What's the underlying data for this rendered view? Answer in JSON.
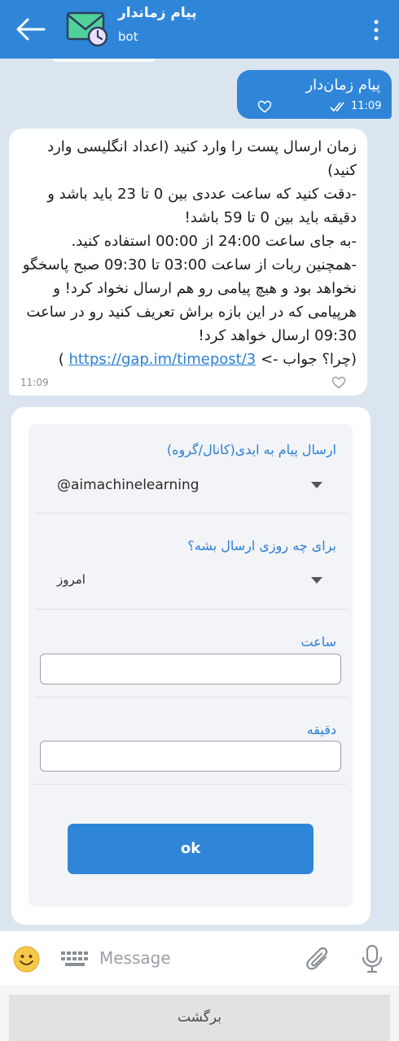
{
  "header": {
    "title": "پیام زماندار",
    "subtitle": "bot",
    "accent_color": "#2f86d9",
    "back_icon": "arrow-left-icon",
    "menu_icon": "more-vertical-icon"
  },
  "outgoing_message": {
    "text": "پیام زمان‌دار",
    "time": "11:09",
    "status_icon": "double-check-icon"
  },
  "incoming_message": {
    "text": "زمان ارسال پست را وارد کنید (اعداد انگلیسی وارد کنید)\n-دقت کنید که ساعت عددی بین 0 تا 23 باید باشد و دقیقه باید بین 0 تا 59 باشد!\n-به جای ساعت 24:00 از  00:00 استفاده کنید.\n-همچنین ربات از ساعت 03:00 تا 09:30 صبح پاسخگو نخواهد بود و هیچ پیامی رو هم ارسال نخواد کرد! و هرپیامی که در این بازه براش تعریف کنید رو در ساعت 09:30 ارسال خواهد کرد!",
    "why_prefix": "(چرا؟ جواب -> ",
    "link": "https://gap.im/timepost/3",
    "why_suffix": " )",
    "time": "11:09"
  },
  "form": {
    "target_label": "ارسال پیام به ایدی(کانال/گروه)",
    "target_value": "@aimachinelearning",
    "day_label": "برای چه روزی ارسال بشه؟",
    "day_value": "امروز",
    "hour_label": "ساعت",
    "hour_value": "",
    "minute_label": "دقیقه",
    "minute_value": "",
    "submit_label": "ok"
  },
  "composer": {
    "placeholder": "Message"
  },
  "keyboard_button": "برگشت"
}
